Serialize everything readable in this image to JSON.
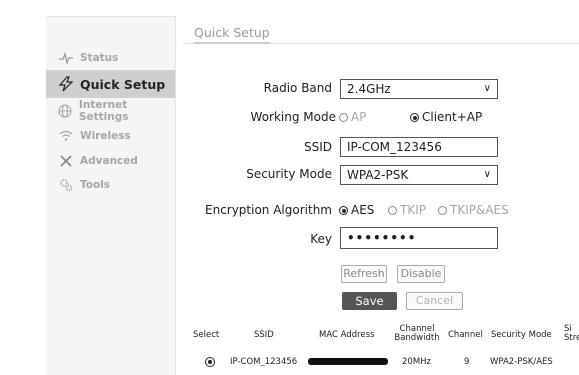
{
  "sidebar": {
    "items": [
      {
        "label": "Status",
        "icon": "pulse-icon"
      },
      {
        "label": "Quick Setup",
        "icon": "lightning-icon",
        "active": true
      },
      {
        "label": "Internet Settings",
        "icon": "globe-icon"
      },
      {
        "label": "Wireless",
        "icon": "wifi-icon"
      },
      {
        "label": "Advanced",
        "icon": "tools-cross-icon"
      },
      {
        "label": "Tools",
        "icon": "gears-icon"
      }
    ]
  },
  "panel": {
    "title": "Quick Setup"
  },
  "form": {
    "radio_band_label": "Radio Band",
    "radio_band_value": "2.4GHz",
    "working_mode_label": "Working Mode",
    "mode_ap": "AP",
    "mode_client": "Client+AP",
    "ssid_label": "SSID",
    "ssid_value": "IP-COM_123456",
    "security_mode_label": "Security Mode",
    "security_mode_value": "WPA2-PSK",
    "encryption_label": "Encryption Algorithm",
    "enc_aes": "AES",
    "enc_tkip": "TKIP",
    "enc_tkipaes": "TKIP&AES",
    "key_label": "Key",
    "key_value": "••••••••"
  },
  "buttons": {
    "refresh": "Refresh",
    "disable": "Disable",
    "save": "Save",
    "cancel": "Cancel"
  },
  "table": {
    "headers": {
      "select": "Select",
      "ssid": "SSID",
      "mac": "MAC Address",
      "bandwidth_1": "Channel",
      "bandwidth_2": "Bandwidth",
      "channel": "Channel",
      "security": "Security Mode",
      "signal_1": "Si",
      "signal_2": "Stre"
    },
    "rows": [
      {
        "ssid": "IP-COM_123456",
        "bandwidth": "20MHz",
        "channel": "9",
        "security": "WPA2-PSK/AES"
      }
    ]
  },
  "colors": {
    "sidebar_bg": "#f5f5f5",
    "active_item_bg": "#cfcfcf",
    "save_bg": "#555555"
  }
}
